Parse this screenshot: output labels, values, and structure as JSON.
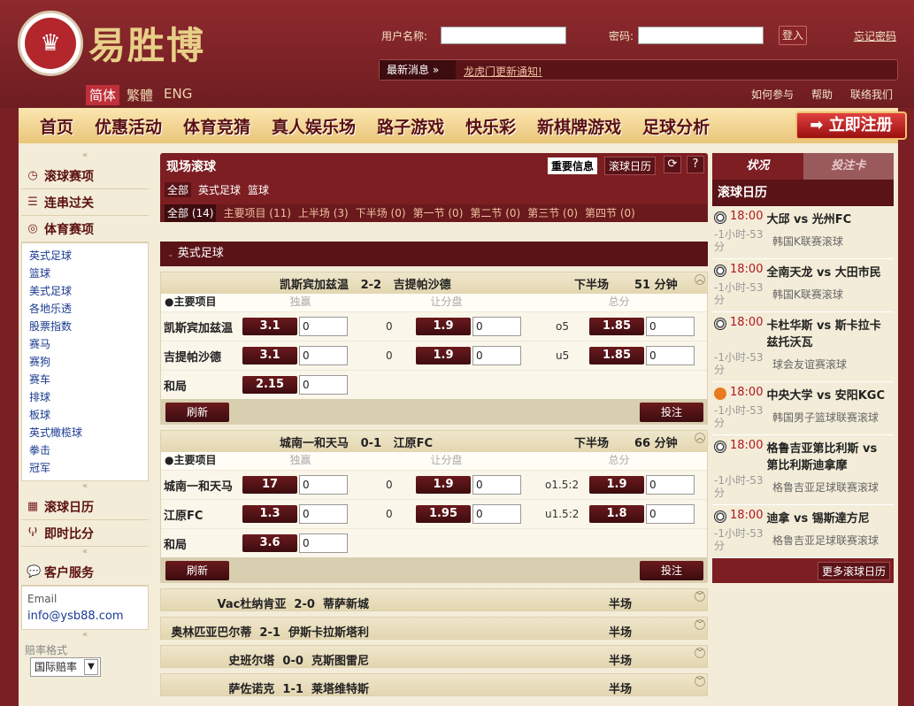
{
  "brand": {
    "name": "易胜博",
    "logo_mark": "♛"
  },
  "langs": [
    "简体",
    "繁體",
    "ENG"
  ],
  "login": {
    "user_label": "用户名称:",
    "pass_label": "密码:",
    "login_btn": "登入",
    "forgot": "忘记密码"
  },
  "news": {
    "label": "最新消息",
    "text": "龙虎门更新通知!"
  },
  "toplinks": [
    "如何参与",
    "帮助",
    "联络我们"
  ],
  "nav": [
    "首页",
    "优惠活动",
    "体育竞猜",
    "真人娱乐场",
    "路子游戏",
    "快乐彩",
    "新棋牌游戏",
    "足球分析"
  ],
  "register": "立即注册",
  "sidebar": {
    "sections": [
      "滚球赛项",
      "连串过关",
      "体育赛项"
    ],
    "sports": [
      "英式足球",
      "篮球",
      "美式足球",
      "各地乐透",
      "股票指数",
      "赛马",
      "赛狗",
      "赛车",
      "排球",
      "板球",
      "英式橄榄球",
      "拳击",
      "冠军"
    ],
    "calendar": "滚球日历",
    "live_score": "即时比分",
    "service": "客户服务",
    "email_label": "Email",
    "email": "info@ysb88.com",
    "odds_label": "赔率格式",
    "odds_value": "国际赔率"
  },
  "live": {
    "title": "现场滚球",
    "important": "重要信息",
    "calendar_btn": "滚球日历",
    "help": "?",
    "sports": [
      "全部",
      "英式足球",
      "篮球"
    ],
    "periods": [
      "全部 (14)",
      "主要项目 (11)",
      "上半场 (3)",
      "下半场 (0)",
      "第一节 (0)",
      "第二节 (0)",
      "第三节 (0)",
      "第四节 (0)"
    ],
    "league": "英式足球",
    "col_main": "主要项目",
    "col_win": "独赢",
    "col_hdp": "让分盘",
    "col_ou": "总分",
    "refresh": "刷新",
    "bet": "投注",
    "draw": "和局",
    "matches": [
      {
        "home": "凯斯宾加兹温",
        "score": "2-2",
        "away": "吉提帕沙德",
        "period": "下半场",
        "minute": "51 分钟",
        "home_win": "3.1",
        "away_win": "3.1",
        "draw_odds": "2.15",
        "hdp_home": "0",
        "hdp_away": "0",
        "hdp_home_odds": "1.9",
        "hdp_away_odds": "1.9",
        "ou_home": "o5",
        "ou_away": "u5",
        "ou_home_odds": "1.85",
        "ou_away_odds": "1.85"
      },
      {
        "home": "城南一和天马",
        "score": "0-1",
        "away": "江原FC",
        "period": "下半场",
        "minute": "66 分钟",
        "home_win": "17",
        "away_win": "1.3",
        "draw_odds": "3.6",
        "hdp_home": "0",
        "hdp_away": "0",
        "hdp_home_odds": "1.9",
        "hdp_away_odds": "1.95",
        "ou_home": "o1.5:2",
        "ou_away": "u1.5:2",
        "ou_home_odds": "1.9",
        "ou_away_odds": "1.8"
      }
    ],
    "stake_default": "0",
    "collapsed": [
      {
        "home": "Vac杜纳肯亚",
        "score": "2-0",
        "away": "蒂萨新城",
        "period": "半场"
      },
      {
        "home": "奥林匹亚巴尔蒂",
        "score": "2-1",
        "away": "伊斯卡拉斯塔利",
        "period": "半场"
      },
      {
        "home": "史班尔塔",
        "score": "0-0",
        "away": "克斯图雷尼",
        "period": "半场"
      },
      {
        "home": "萨佐诺克",
        "score": "1-1",
        "away": "莱塔维特斯",
        "period": "半场"
      }
    ]
  },
  "right": {
    "tab_status": "状况",
    "tab_bet": "投注卡",
    "title": "滚球日历",
    "more": "更多滚球日历",
    "events": [
      {
        "time": "18:00",
        "name": "大邱 vs 光州FC",
        "countdown": "-1小时-53分",
        "league": "韩国K联赛滚球",
        "sport": "soccer"
      },
      {
        "time": "18:00",
        "name": "全南天龙 vs 大田市民",
        "countdown": "-1小时-53分",
        "league": "韩国K联赛滚球",
        "sport": "soccer"
      },
      {
        "time": "18:00",
        "name": "卡杜华斯 vs 斯卡拉卡兹托沃瓦",
        "countdown": "-1小时-53分",
        "league": "球会友谊赛滚球",
        "sport": "soccer"
      },
      {
        "time": "18:00",
        "name": "中央大学 vs 安阳KGC",
        "countdown": "-1小时-53分",
        "league": "韩国男子篮球联赛滚球",
        "sport": "basketball"
      },
      {
        "time": "18:00",
        "name": "格鲁吉亚第比利斯 vs 第比利斯迪拿摩",
        "countdown": "-1小时-53分",
        "league": "格鲁吉亚足球联赛滚球",
        "sport": "soccer"
      },
      {
        "time": "18:00",
        "name": "迪拿 vs 锡斯達方尼",
        "countdown": "-1小时-53分",
        "league": "格鲁吉亚足球联赛滚球",
        "sport": "soccer"
      }
    ]
  }
}
